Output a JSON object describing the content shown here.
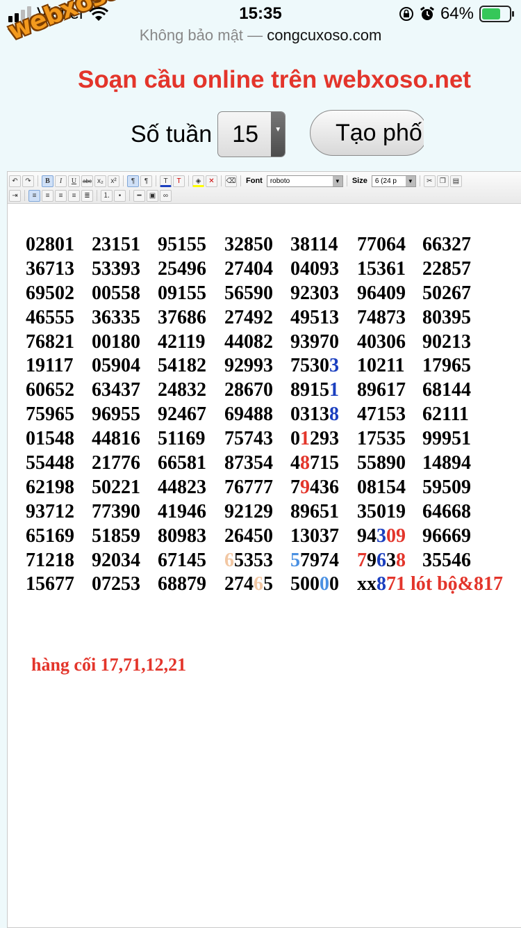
{
  "status_bar": {
    "carrier": "Viettel",
    "time": "15:35",
    "battery": "64%"
  },
  "address_bar": {
    "security": "Không bảo mật",
    "separator": "—",
    "domain": "congcuxoso.com"
  },
  "watermark": "webxoso.net",
  "page": {
    "title": "Soạn cầu online trên webxoso.net",
    "weeks_label": "Số tuần",
    "weeks_value": "15",
    "create_button": "Tạo phố"
  },
  "toolbar": {
    "font_label": "Font",
    "font_value": "roboto",
    "size_label": "Size",
    "size_value": "6 (24 p"
  },
  "colors": {
    "red": "#e3352b",
    "blue": "#1b3fbf",
    "sky": "#4a90e2",
    "peach": "#f2c7a3"
  },
  "grid": {
    "rows": [
      [
        [
          "02801"
        ],
        [
          "23151"
        ],
        [
          "95155"
        ],
        [
          "32850"
        ],
        [
          "38114"
        ],
        [
          "77064"
        ],
        [
          "66327"
        ]
      ],
      [
        [
          "36713"
        ],
        [
          "53393"
        ],
        [
          "25496"
        ],
        [
          "27404"
        ],
        [
          "04093"
        ],
        [
          "15361"
        ],
        [
          "22857"
        ]
      ],
      [
        [
          "69502"
        ],
        [
          "00558"
        ],
        [
          "09155"
        ],
        [
          "56590"
        ],
        [
          "92303"
        ],
        [
          "96409"
        ],
        [
          "50267"
        ]
      ],
      [
        [
          "46555"
        ],
        [
          "36335"
        ],
        [
          "37686"
        ],
        [
          "27492"
        ],
        [
          "49513"
        ],
        [
          "74873"
        ],
        [
          "80395"
        ]
      ],
      [
        [
          "76821"
        ],
        [
          "00180"
        ],
        [
          "42119"
        ],
        [
          "44082"
        ],
        [
          "93970"
        ],
        [
          "40306"
        ],
        [
          "90213"
        ]
      ],
      [
        [
          "19117"
        ],
        [
          "05904"
        ],
        [
          "54182"
        ],
        [
          "92993"
        ],
        [
          "7530",
          [
            "3",
            "blue"
          ]
        ],
        [
          "10211"
        ],
        [
          "17965"
        ]
      ],
      [
        [
          "60652"
        ],
        [
          "63437"
        ],
        [
          "24832"
        ],
        [
          "28670"
        ],
        [
          "8915",
          [
            "1",
            "blue"
          ]
        ],
        [
          "89617"
        ],
        [
          "68144"
        ]
      ],
      [
        [
          "75965"
        ],
        [
          "96955"
        ],
        [
          "92467"
        ],
        [
          "69488"
        ],
        [
          "0313",
          [
            "8",
            "blue"
          ]
        ],
        [
          "47153"
        ],
        [
          "62111"
        ]
      ],
      [
        [
          "01548"
        ],
        [
          "44816"
        ],
        [
          "51169"
        ],
        [
          "75743"
        ],
        [
          "0",
          [
            "1",
            "red"
          ],
          "293"
        ],
        [
          "17535"
        ],
        [
          "99951"
        ]
      ],
      [
        [
          "55448"
        ],
        [
          "21776"
        ],
        [
          "66581"
        ],
        [
          "87354"
        ],
        [
          "4",
          [
            "8",
            "red"
          ],
          "715"
        ],
        [
          "55890"
        ],
        [
          "14894"
        ]
      ],
      [
        [
          "62198"
        ],
        [
          "50221"
        ],
        [
          "44823"
        ],
        [
          "76777"
        ],
        [
          "7",
          [
            "9",
            "red"
          ],
          "436"
        ],
        [
          "08154"
        ],
        [
          "59509"
        ]
      ],
      [
        [
          "93712"
        ],
        [
          "77390"
        ],
        [
          "41946"
        ],
        [
          "92129"
        ],
        [
          "89651"
        ],
        [
          "35019"
        ],
        [
          "64668"
        ]
      ],
      [
        [
          "65169"
        ],
        [
          "51859"
        ],
        [
          "80983"
        ],
        [
          "26450"
        ],
        [
          "13037"
        ],
        [
          "94",
          [
            "3",
            "blue"
          ],
          [
            "0",
            "red"
          ],
          [
            "9",
            "red"
          ]
        ],
        [
          "96669"
        ]
      ],
      [
        [
          "71218"
        ],
        [
          "92034"
        ],
        [
          "67145"
        ],
        [
          [
            "6",
            "peach"
          ],
          "5353"
        ],
        [
          [
            "5",
            "sky"
          ],
          "7974"
        ],
        [
          [
            "7",
            "red"
          ],
          "9",
          [
            "6",
            "blue"
          ],
          "3",
          [
            "8",
            "red"
          ]
        ],
        [
          "35546"
        ]
      ],
      [
        [
          "15677"
        ],
        [
          "07253"
        ],
        [
          "68879"
        ],
        [
          "274",
          [
            "6",
            "peach"
          ],
          "5"
        ],
        [
          "500",
          [
            "0",
            "sky"
          ],
          "0"
        ],
        [
          "xx",
          [
            "8",
            "blue"
          ],
          [
            "71 lót bộ&817",
            "red"
          ]
        ]
      ]
    ],
    "note": "hàng cối 17,71,12,21"
  }
}
